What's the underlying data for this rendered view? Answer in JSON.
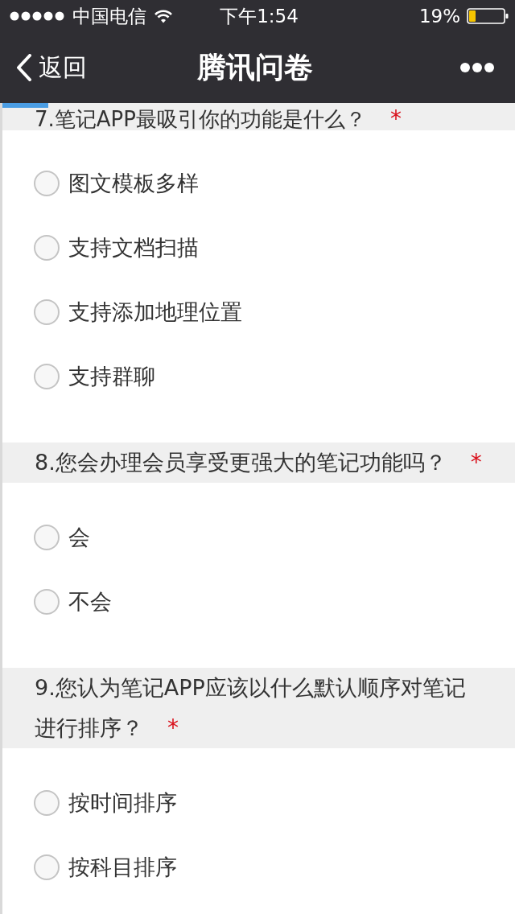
{
  "status_bar": {
    "carrier": "中国电信",
    "time": "下午1:54",
    "battery": "19%"
  },
  "nav_bar": {
    "back": "返回",
    "title": "腾讯问卷"
  },
  "progress": {
    "level": 0.09
  },
  "questions": [
    {
      "title": "7.笔记APP最吸引你的功能是什么？",
      "required_mark": "*",
      "options": [
        {
          "label": "图文模板多样",
          "selected": false
        },
        {
          "label": "支持文档扫描",
          "selected": false
        },
        {
          "label": "支持添加地理位置",
          "selected": false
        },
        {
          "label": "支持群聊",
          "selected": false
        }
      ]
    },
    {
      "title": "8.您会办理会员享受更强大的笔记功能吗？",
      "required_mark": "*",
      "options": [
        {
          "label": "会",
          "selected": false
        },
        {
          "label": "不会",
          "selected": false
        }
      ]
    },
    {
      "title": "9.您认为笔记APP应该以什么默认顺序对笔记进行排序？",
      "required_mark": "*",
      "options": [
        {
          "label": "按时间排序",
          "selected": false
        },
        {
          "label": "按科目排序",
          "selected": false
        }
      ]
    }
  ]
}
